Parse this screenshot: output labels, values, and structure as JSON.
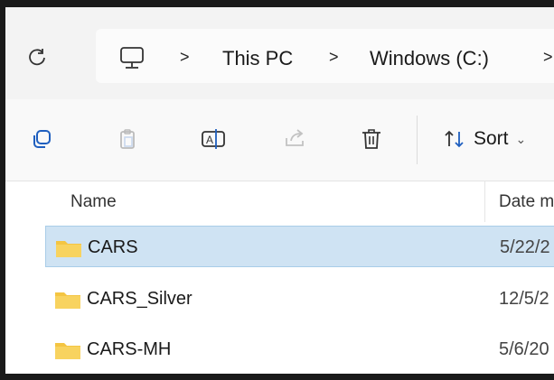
{
  "breadcrumb": {
    "items": [
      "This PC",
      "Windows (C:)"
    ],
    "separator": ">"
  },
  "toolbar": {
    "sort_label": "Sort"
  },
  "list": {
    "columns": [
      "Name",
      "Date m"
    ],
    "rows": [
      {
        "name": "CARS",
        "date": "5/22/2",
        "selected": true
      },
      {
        "name": "CARS_Silver",
        "date": "12/5/2",
        "selected": false
      },
      {
        "name": "CARS-MH",
        "date": "5/6/20",
        "selected": false
      }
    ]
  },
  "colors": {
    "selection": "#cfe3f3",
    "folder": "#f4c542"
  }
}
